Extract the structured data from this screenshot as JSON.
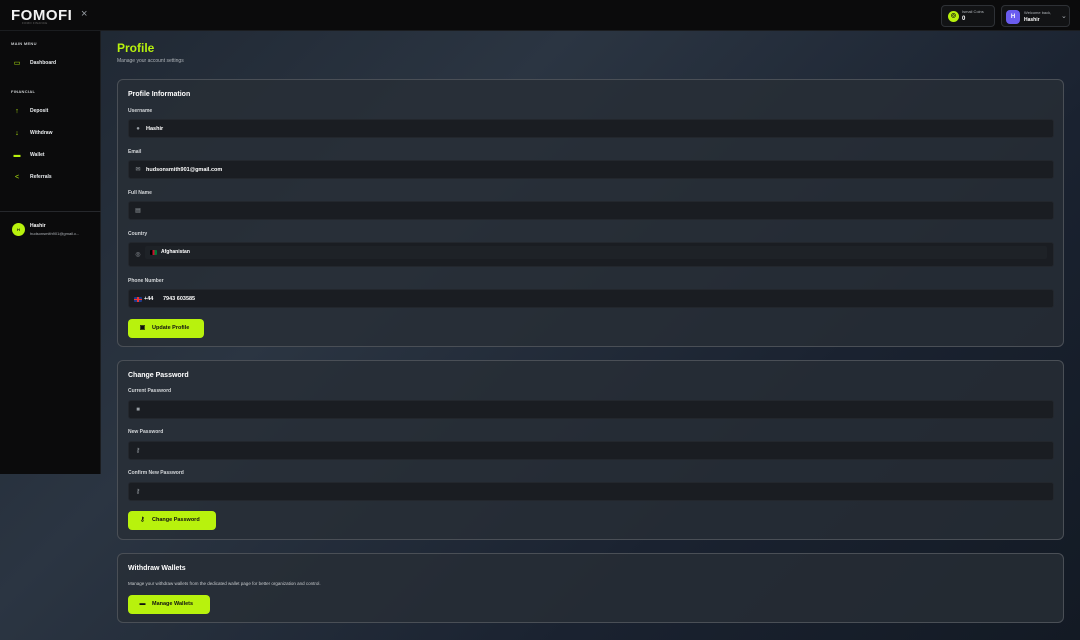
{
  "brand": {
    "logo": "FOMOFI",
    "tagline": "FOMO FINANCE"
  },
  "topbar": {
    "close_glyph": "×",
    "coins": {
      "label": "Ismail Coins",
      "value": "0",
      "icon_letter": "◎"
    },
    "user": {
      "welcome": "Welcome back,",
      "name": "Hashir",
      "avatar_letter": "H",
      "chevron": "⌄"
    }
  },
  "sidebar": {
    "main_menu_label": "MAIN MENU",
    "financial_label": "FINANCIAL",
    "items": [
      {
        "label": "Dashboard",
        "icon": "monitor-icon",
        "glyph": "▭"
      },
      {
        "label": "Deposit",
        "icon": "arrow-up-icon",
        "glyph": "↑"
      },
      {
        "label": "Withdraw",
        "icon": "arrow-down-icon",
        "glyph": "↓"
      },
      {
        "label": "Wallet",
        "icon": "wallet-icon",
        "glyph": "▬"
      },
      {
        "label": "Referrals",
        "icon": "share-icon",
        "glyph": "<"
      }
    ],
    "profile": {
      "avatar_letter": "H",
      "name": "Hashir",
      "email": "hudsonsmith901@gmail.c..."
    }
  },
  "page": {
    "title": "Profile",
    "subtitle": "Manage your account settings"
  },
  "profile_info": {
    "title": "Profile Information",
    "username": {
      "label": "Username",
      "value": "Hashir",
      "icon": "user-icon",
      "glyph": "●"
    },
    "email": {
      "label": "Email",
      "value": "hudsonsmith901@gmail.com",
      "icon": "mail-icon",
      "glyph": "✉"
    },
    "full_name": {
      "label": "Full Name",
      "value": "",
      "icon": "id-card-icon",
      "glyph": "▤"
    },
    "country": {
      "label": "Country",
      "value": "Afghanistan",
      "icon": "globe-icon",
      "glyph": "◎"
    },
    "phone": {
      "label": "Phone Number",
      "dial_code": "+44",
      "number": "7943 603585"
    },
    "button": {
      "label": "Update Profile",
      "glyph": "💾"
    }
  },
  "change_password": {
    "title": "Change Password",
    "current": {
      "label": "Current Password",
      "value": "",
      "glyph": "🔒"
    },
    "new": {
      "label": "New Password",
      "value": "",
      "glyph": "🔑"
    },
    "confirm": {
      "label": "Confirm New Password",
      "value": "",
      "glyph": "🔑"
    },
    "button": {
      "label": "Change Password",
      "glyph": "🔑"
    }
  },
  "withdraw_wallets": {
    "title": "Withdraw Wallets",
    "description": "Manage your withdraw wallets from the dedicated wallet page for better organization and control.",
    "button": {
      "label": "Manage Wallets",
      "glyph": "▬"
    }
  },
  "colors": {
    "accent": "#b8f20d",
    "sidebar_bg": "#0b0b0c",
    "input_bg": "#1a1d22",
    "avatar_purple": "#6a5cf0"
  }
}
